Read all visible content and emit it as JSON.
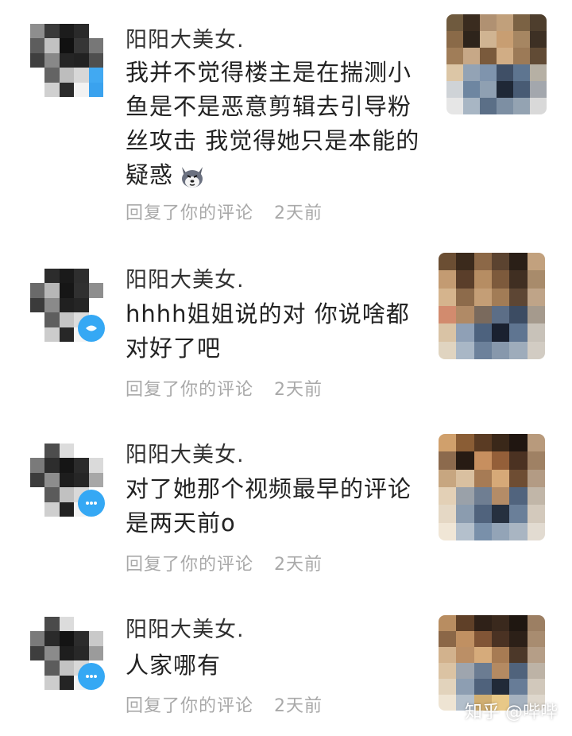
{
  "colors": {
    "text_primary": "#222222",
    "meta": "#a9a9a9",
    "badge": "#35a8f4",
    "watermark": "#ffffff"
  },
  "comments": [
    {
      "user_name": "阳阳大美女.",
      "text": "我并不觉得楼主是在揣测小鱼是不是恶意剪辑去引导粉丝攻击 我觉得她只是本能的疑惑",
      "emoji": "husky-face-emoji",
      "reply_link": "回复了你的评论",
      "time_ago": "2天前"
    },
    {
      "user_name": "阳阳大美女.",
      "text": "hhhh姐姐说的对 你说啥都对好了吧",
      "reply_link": "回复了你的评论",
      "time_ago": "2天前"
    },
    {
      "user_name": "阳阳大美女.",
      "text": "对了她那个视频最早的评论是两天前o",
      "reply_link": "回复了你的评论",
      "time_ago": "2天前"
    },
    {
      "user_name": "阳阳大美女.",
      "text": "人家哪有",
      "reply_link": "回复了你的评论",
      "time_ago": "2天前"
    }
  ],
  "watermark": "知乎 @哔哔"
}
